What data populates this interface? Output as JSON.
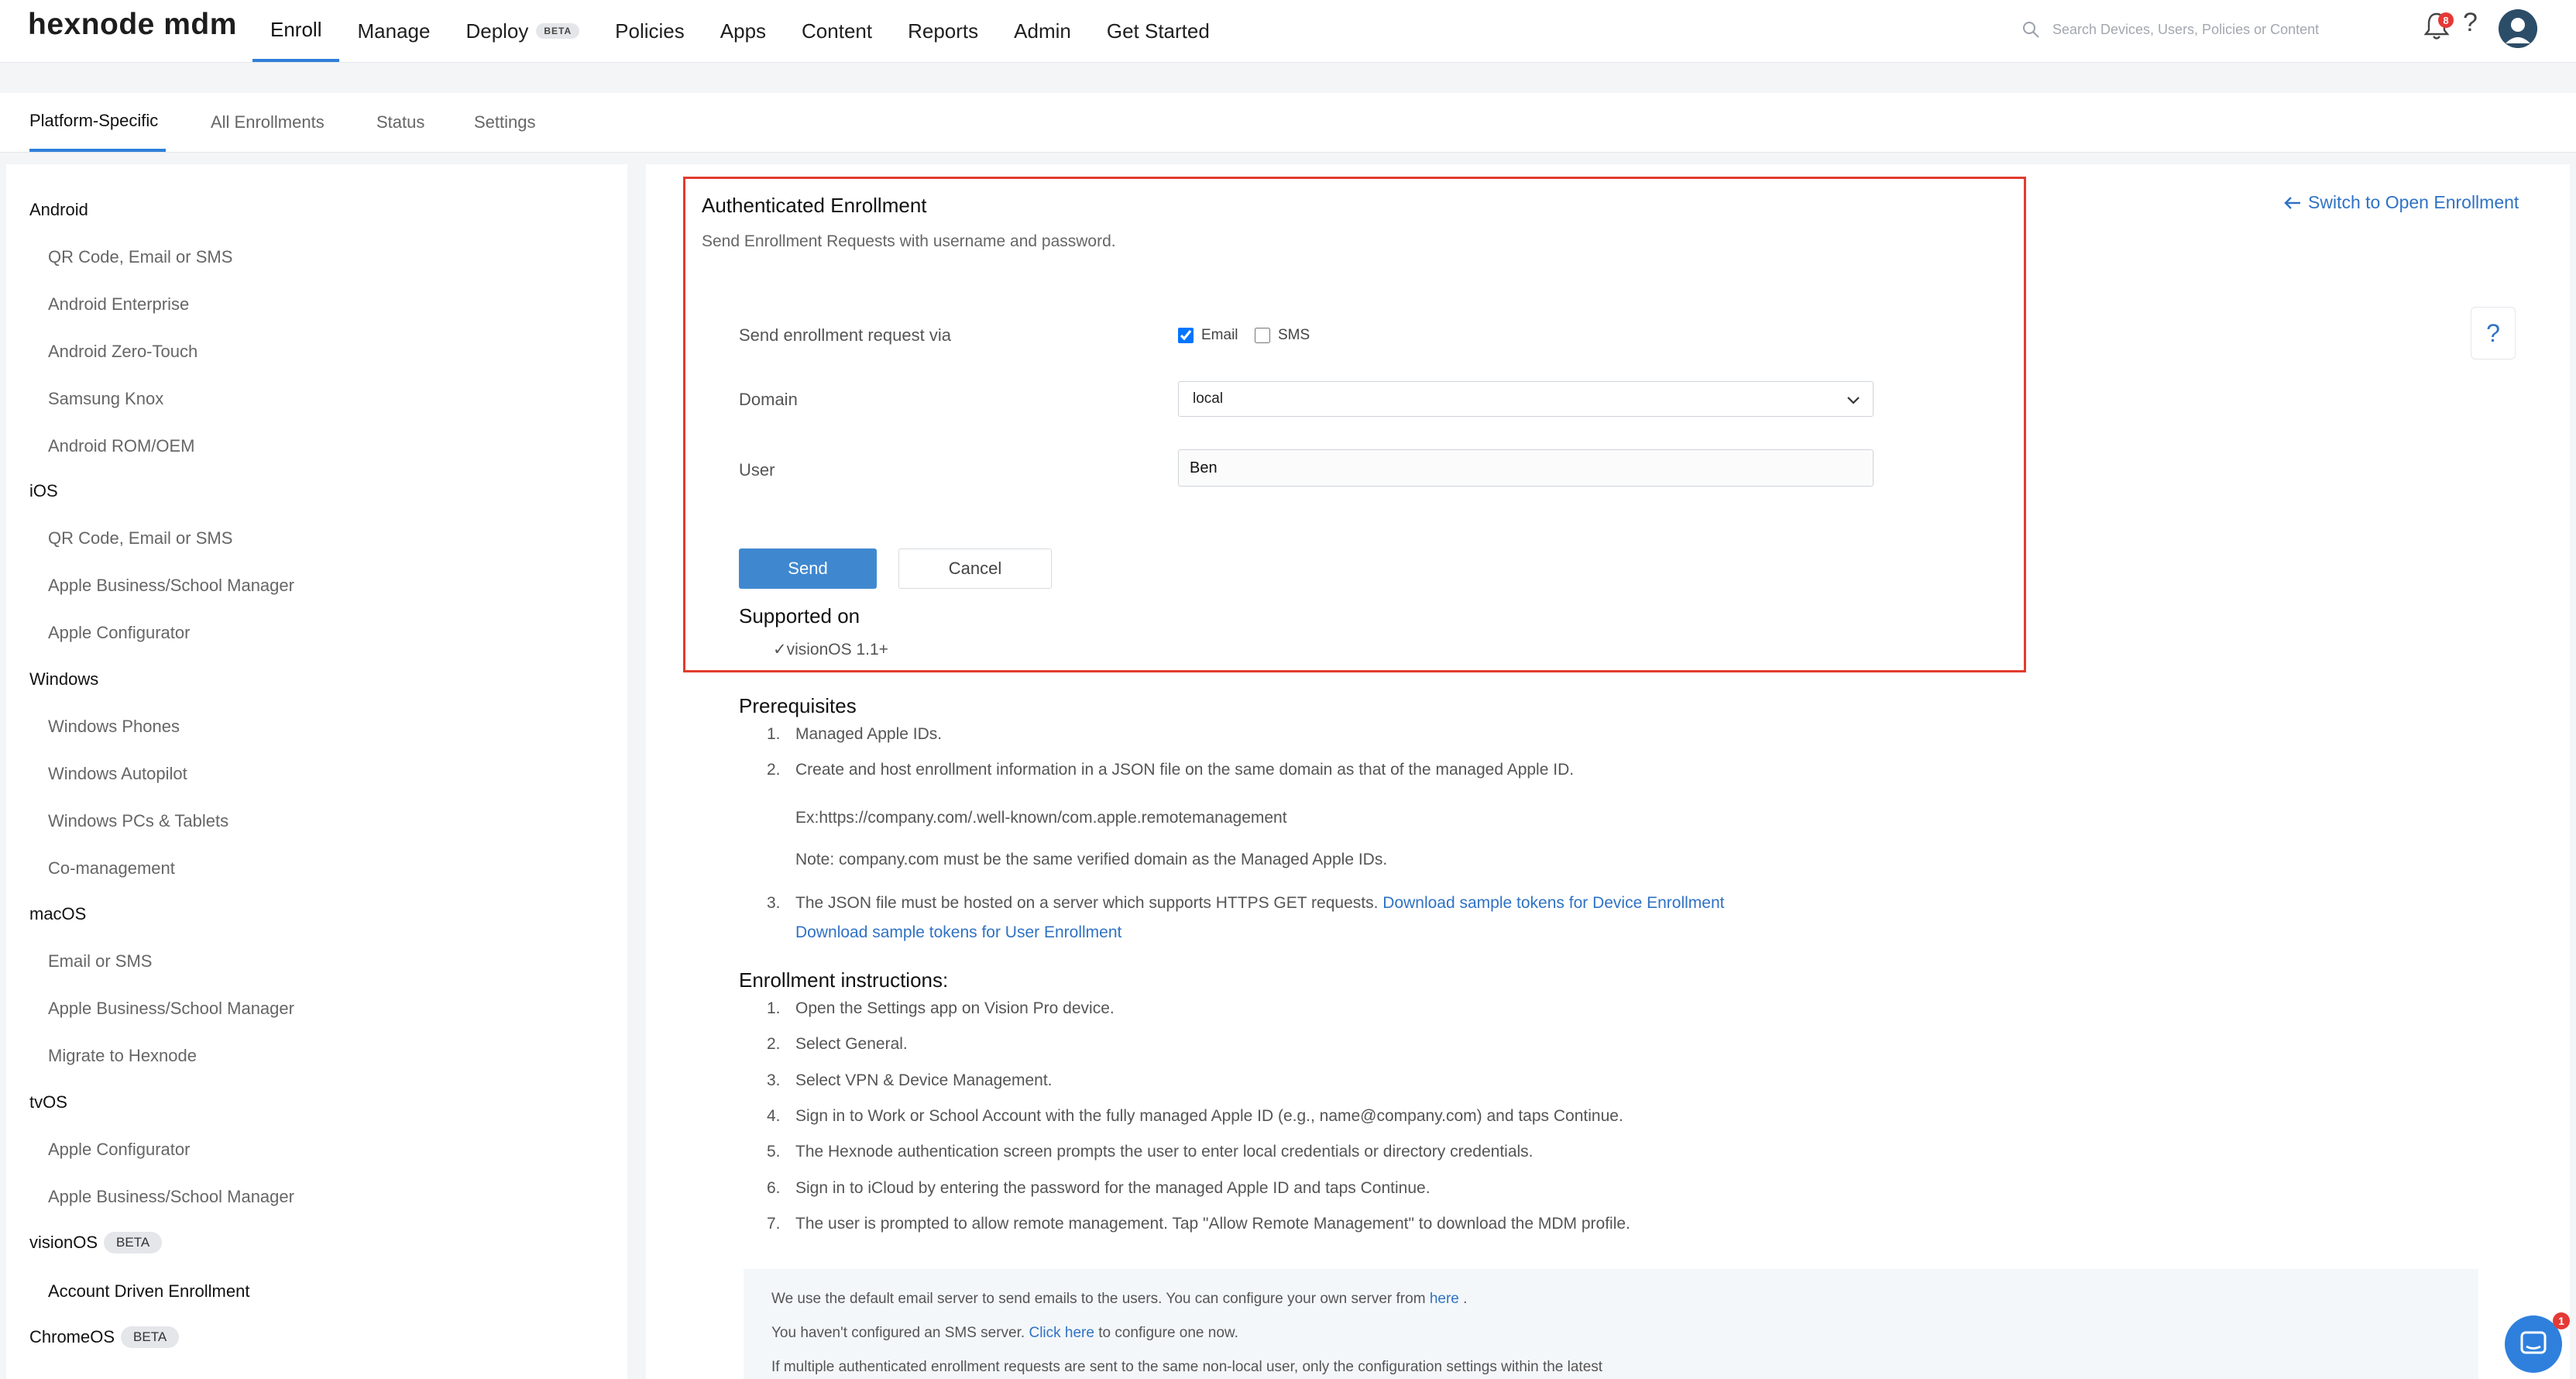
{
  "app": {
    "logo_text": "hexnode mdm"
  },
  "nav": {
    "items": [
      {
        "label": "Enroll",
        "active": true
      },
      {
        "label": "Manage"
      },
      {
        "label": "Deploy",
        "badge": "BETA"
      },
      {
        "label": "Policies"
      },
      {
        "label": "Apps"
      },
      {
        "label": "Content"
      },
      {
        "label": "Reports"
      },
      {
        "label": "Admin"
      },
      {
        "label": "Get Started"
      }
    ]
  },
  "search": {
    "placeholder": "Search Devices, Users, Policies or Content"
  },
  "notifications": {
    "count": "8"
  },
  "subtabs": [
    "Platform-Specific",
    "All Enrollments",
    "Status",
    "Settings"
  ],
  "sidebar": {
    "groups": [
      {
        "heading": "Android",
        "items": [
          "QR Code, Email or SMS",
          "Android Enterprise",
          "Android Zero-Touch",
          "Samsung Knox",
          "Android ROM/OEM"
        ]
      },
      {
        "heading": "iOS",
        "items": [
          "QR Code, Email or SMS",
          "Apple Business/School Manager",
          "Apple Configurator"
        ]
      },
      {
        "heading": "Windows",
        "items": [
          "Windows Phones",
          "Windows Autopilot",
          "Windows PCs & Tablets",
          "Co-management"
        ]
      },
      {
        "heading": "macOS",
        "items": [
          "Email or SMS",
          "Apple Business/School Manager",
          "Migrate to Hexnode"
        ]
      },
      {
        "heading": "tvOS",
        "items": [
          "Apple Configurator",
          "Apple Business/School Manager"
        ]
      },
      {
        "heading": "visionOS",
        "badge": "BETA",
        "items": [
          "Account Driven Enrollment"
        ]
      },
      {
        "heading": "ChromeOS",
        "badge": "BETA",
        "items": []
      }
    ]
  },
  "main": {
    "title": "Authenticated Enrollment",
    "subtitle": "Send Enrollment Requests with username and password.",
    "switch_link": "Switch to Open Enrollment",
    "help": "?",
    "form": {
      "send_via_label": "Send enrollment request via",
      "email_label": "Email",
      "sms_label": "SMS",
      "domain_label": "Domain",
      "domain_value": "local",
      "user_label": "User",
      "user_value": "Ben",
      "send_button": "Send",
      "cancel_button": "Cancel"
    },
    "supported": {
      "heading": "Supported on",
      "item": "✓visionOS 1.1+"
    },
    "prerequisites": {
      "heading": "Prerequisites",
      "n1": "1.",
      "t1": "Managed Apple IDs.",
      "n2": "2.",
      "t2": "Create and host enrollment information in a JSON file on the same domain as that of the managed Apple ID.",
      "example": "Ex:https://company.com/.well-known/com.apple.remotemanagement",
      "note": "Note: company.com must be the same verified domain as the Managed Apple IDs.",
      "n3": "3.",
      "t3": "The JSON file must be hosted on a server which supports HTTPS GET requests.",
      "link_device": "Download sample tokens for Device Enrollment",
      "link_user": "Download sample tokens for User Enrollment"
    },
    "instructions": {
      "heading": "Enrollment instructions:",
      "steps": [
        {
          "n": "1.",
          "t": "Open the Settings app on Vision Pro device."
        },
        {
          "n": "2.",
          "t": "Select General."
        },
        {
          "n": "3.",
          "t": "Select VPN & Device Management."
        },
        {
          "n": "4.",
          "t": "Sign in to Work or School Account with the fully managed Apple ID (e.g., name@company.com) and taps Continue."
        },
        {
          "n": "5.",
          "t": "The Hexnode authentication screen prompts the user to enter local credentials or directory credentials."
        },
        {
          "n": "6.",
          "t": "Sign in to iCloud by entering the password for the managed Apple ID and taps Continue."
        },
        {
          "n": "7.",
          "t": "The user is prompted to allow remote management. Tap \"Allow Remote Management\" to download the MDM profile."
        }
      ]
    },
    "info": {
      "line1": "We use the default email server to send emails to the users. You can configure your own server from",
      "line1_link": "here",
      "line1_end": ".",
      "line2": "You haven't configured an SMS server.",
      "line2_link": "Click here",
      "line2_end": "to configure one now.",
      "line3": "If multiple authenticated enrollment requests are sent to the same non-local user, only the configuration settings within the latest"
    }
  },
  "chat": {
    "badge": "1"
  },
  "colors": {
    "accent": "#2e7fd9",
    "link": "#2f72c4",
    "highlight_border": "#e23b2d",
    "primary_button": "#3f88d0"
  }
}
